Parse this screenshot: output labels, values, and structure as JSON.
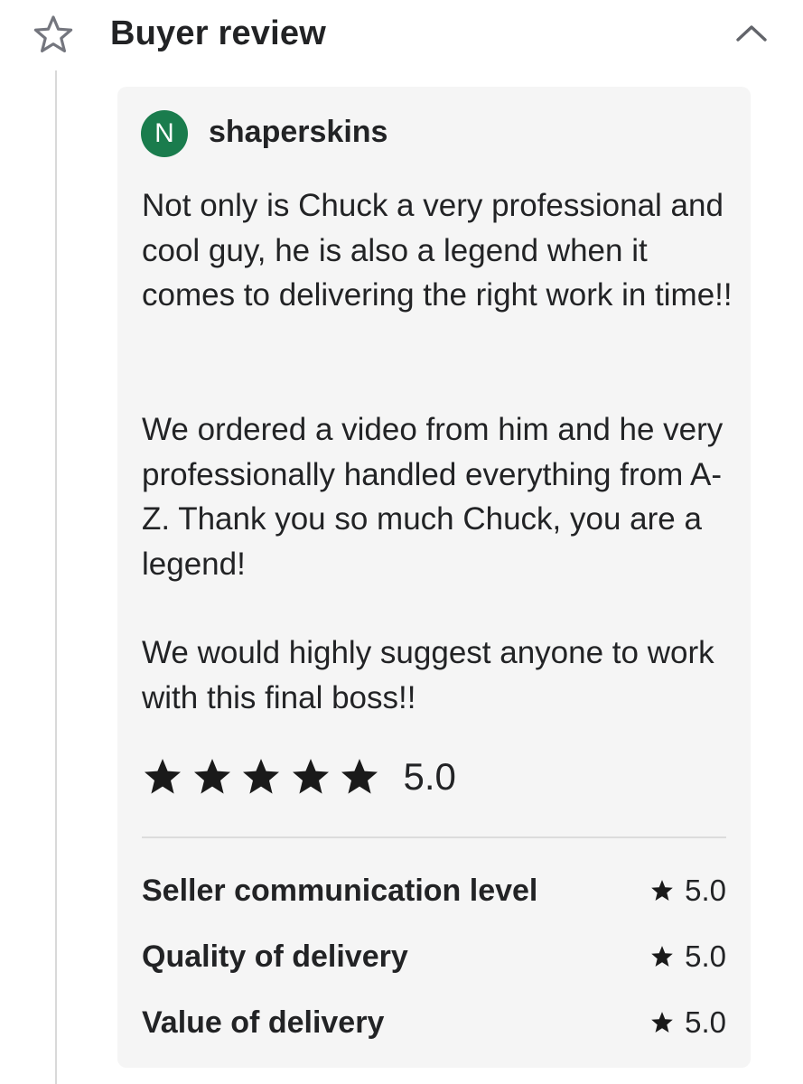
{
  "header": {
    "title": "Buyer review",
    "icon": "star-outline-icon",
    "collapse_icon": "chevron-up-icon"
  },
  "review": {
    "avatar_initial": "N",
    "avatar_color": "#1a7c4d",
    "username": "shaperskins",
    "paragraphs": [
      "Not only is Chuck a very professional and cool guy, he is also a legend when it comes to delivering the right work in time!!",
      "We ordered a video from him and he very professionally handled everything from A-Z. Thank you so much Chuck, you are a legend!",
      "We would highly suggest anyone to work with this final boss!!"
    ],
    "overall_rating": "5.0",
    "stars_filled": 5,
    "stars_total": 5
  },
  "sub_ratings": [
    {
      "label": "Seller communication level",
      "value": "5.0"
    },
    {
      "label": "Quality of delivery",
      "value": "5.0"
    },
    {
      "label": "Value of delivery",
      "value": "5.0"
    }
  ],
  "colors": {
    "text": "#222325",
    "card_background": "#f5f5f5",
    "accent_green": "#1a7c4d"
  }
}
